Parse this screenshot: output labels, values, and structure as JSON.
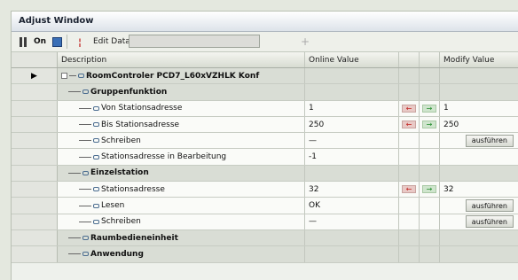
{
  "window": {
    "title": "Adjust Window"
  },
  "toolbar": {
    "online_label": "On",
    "edit_data_label": "Edit Data",
    "plus_label": "+"
  },
  "columns": {
    "description": "Description",
    "online": "Online Value",
    "modify": "Modify Value"
  },
  "rows": [
    {
      "type": "root",
      "label": "RoomControler PCD7_L60xVZHLK Konf"
    },
    {
      "type": "group",
      "label": "Gruppenfunktion"
    },
    {
      "type": "item",
      "label": "Von Stationsadresse",
      "online": "1",
      "modify": "1"
    },
    {
      "type": "item",
      "label": "Bis Stationsadresse",
      "online": "250",
      "modify": "250"
    },
    {
      "type": "item",
      "label": "Schreiben",
      "online": "—",
      "button": "ausführen"
    },
    {
      "type": "item",
      "label": "Stationsadresse in Bearbeitung",
      "online": "-1"
    },
    {
      "type": "group",
      "label": "Einzelstation"
    },
    {
      "type": "item",
      "label": "Stationsadresse",
      "online": "32",
      "modify": "32"
    },
    {
      "type": "item",
      "label": "Lesen",
      "online": "OK",
      "button": "ausführen"
    },
    {
      "type": "item",
      "label": "Schreiben",
      "online": "—",
      "button": "ausführen"
    },
    {
      "type": "group",
      "label": "Raumbedieneinheit"
    },
    {
      "type": "group",
      "label": "Anwendung"
    }
  ]
}
